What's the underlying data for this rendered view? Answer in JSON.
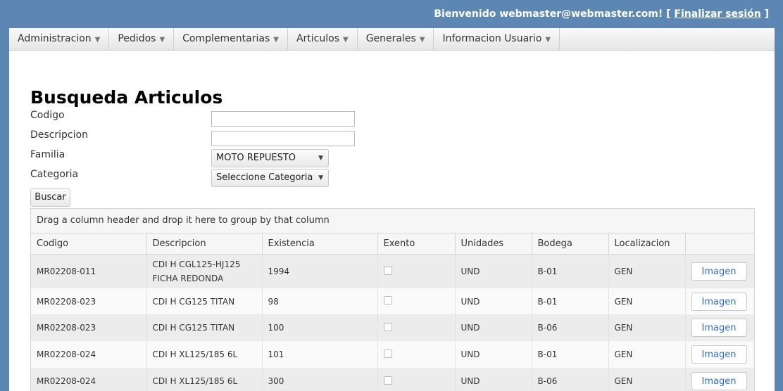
{
  "header": {
    "greeting": "Bienvenido",
    "user": "webmaster@webmaster.com!",
    "bracket_open": "[",
    "logout": "Finalizar sesión",
    "bracket_close": "]"
  },
  "menu": [
    {
      "label": "Administracion"
    },
    {
      "label": "Pedidos"
    },
    {
      "label": "Complementarias"
    },
    {
      "label": "Articulos"
    },
    {
      "label": "Generales"
    },
    {
      "label": "Informacion Usuario"
    }
  ],
  "page": {
    "title": "Busqueda Articulos"
  },
  "form": {
    "codigo_label": "Codigo",
    "codigo_value": "",
    "descripcion_label": "Descripcion",
    "descripcion_value": "",
    "familia_label": "Familia",
    "familia_value": "MOTO REPUESTO",
    "categoria_label": "Categoria",
    "categoria_value": "Seleccione Categoria",
    "buscar_label": "Buscar"
  },
  "grid": {
    "group_hint": "Drag a column header and drop it here to group by that column",
    "columns": [
      "Codigo",
      "Descripcion",
      "Existencia",
      "Exento",
      "Unidades",
      "Bodega",
      "Localizacion",
      ""
    ],
    "rows": [
      {
        "codigo": "MR02208-011",
        "descripcion": "CDI H CGL125-HJ125 FICHA REDONDA",
        "existencia": "1994",
        "exento": false,
        "unidades": "UND",
        "bodega": "B-01",
        "localizacion": "GEN",
        "action": "Imagen"
      },
      {
        "codigo": "MR02208-023",
        "descripcion": "CDI H CG125 TITAN",
        "existencia": "98",
        "exento": false,
        "unidades": "UND",
        "bodega": "B-01",
        "localizacion": "GEN",
        "action": "Imagen"
      },
      {
        "codigo": "MR02208-023",
        "descripcion": "CDI H CG125 TITAN",
        "existencia": "100",
        "exento": false,
        "unidades": "UND",
        "bodega": "B-06",
        "localizacion": "GEN",
        "action": "Imagen"
      },
      {
        "codigo": "MR02208-024",
        "descripcion": "CDI H XL125/185 6L",
        "existencia": "101",
        "exento": false,
        "unidades": "UND",
        "bodega": "B-01",
        "localizacion": "GEN",
        "action": "Imagen"
      },
      {
        "codigo": "MR02208-024",
        "descripcion": "CDI H XL125/185 6L",
        "existencia": "300",
        "exento": false,
        "unidades": "UND",
        "bodega": "B-06",
        "localizacion": "GEN",
        "action": "Imagen"
      }
    ]
  }
}
